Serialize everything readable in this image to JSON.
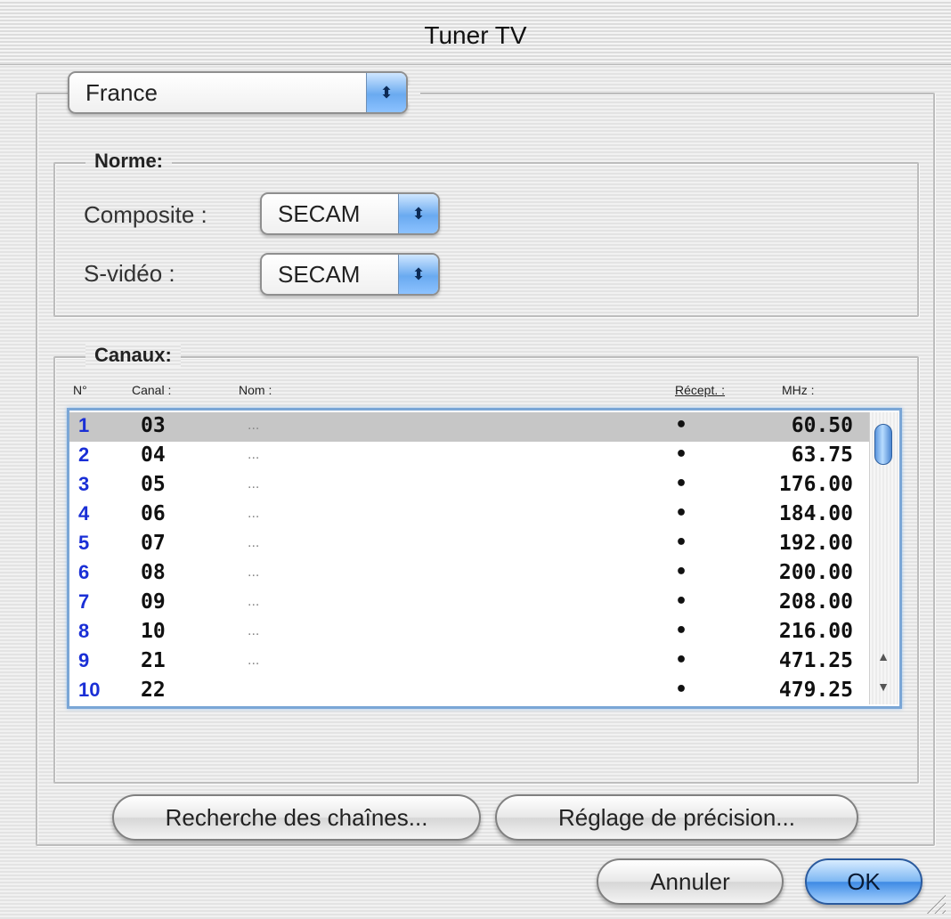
{
  "window": {
    "title": "Tuner TV"
  },
  "country": {
    "selected": "France"
  },
  "norme": {
    "legend": "Norme:",
    "composite_label": "Composite :",
    "composite_value": "SECAM",
    "svideo_label": "S-vidéo :",
    "svideo_value": "SECAM"
  },
  "canaux": {
    "legend": "Canaux:",
    "columns": {
      "num": "N°",
      "canal": "Canal :",
      "nom": "Nom :",
      "recept": "Récept. :",
      "mhz": "MHz :"
    },
    "rows": [
      {
        "num": "1",
        "canal": "03",
        "nom": "...",
        "recept": "•",
        "mhz": "60.50"
      },
      {
        "num": "2",
        "canal": "04",
        "nom": "...",
        "recept": "•",
        "mhz": "63.75"
      },
      {
        "num": "3",
        "canal": "05",
        "nom": "...",
        "recept": "•",
        "mhz": "176.00"
      },
      {
        "num": "4",
        "canal": "06",
        "nom": "...",
        "recept": "•",
        "mhz": "184.00"
      },
      {
        "num": "5",
        "canal": "07",
        "nom": "...",
        "recept": "•",
        "mhz": "192.00"
      },
      {
        "num": "6",
        "canal": "08",
        "nom": "...",
        "recept": "•",
        "mhz": "200.00"
      },
      {
        "num": "7",
        "canal": "09",
        "nom": "...",
        "recept": "•",
        "mhz": "208.00"
      },
      {
        "num": "8",
        "canal": "10",
        "nom": "...",
        "recept": "•",
        "mhz": "216.00"
      },
      {
        "num": "9",
        "canal": "21",
        "nom": "...",
        "recept": "•",
        "mhz": "471.25"
      },
      {
        "num": "10",
        "canal": "22",
        "nom": "",
        "recept": "•",
        "mhz": "479.25"
      }
    ]
  },
  "icons": {
    "popup_arrows": "up-down-arrows-icon",
    "scroll_up": "▲",
    "scroll_down": "▼",
    "popup_glyph": "⬍"
  },
  "buttons": {
    "search": "Recherche des chaînes...",
    "fine_tune": "Réglage de précision...",
    "cancel": "Annuler",
    "ok": "OK"
  },
  "colors": {
    "accent": "#3d8ae4",
    "channel_number": "#1a2fd6",
    "selection": "#c6c6c6"
  }
}
